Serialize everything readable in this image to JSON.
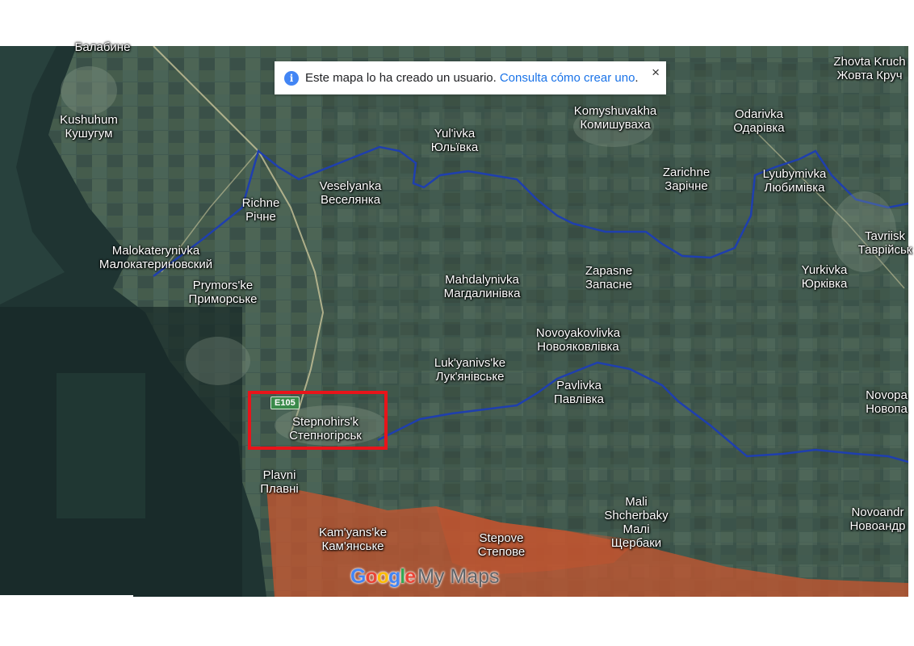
{
  "banner": {
    "text": "Este mapa lo ha creado un usuario.",
    "link": "Consulta cómo crear uno",
    "suffix": ".",
    "close": "×",
    "info_icon": "i"
  },
  "highway": "E105",
  "logo": {
    "g1": "G",
    "g2": "o",
    "g3": "o",
    "g4": "g",
    "g5": "l",
    "g6": "e",
    "mymaps": "My Maps"
  },
  "places": [
    {
      "id": "balabyne",
      "latin": "",
      "cyr": "Балабине"
    },
    {
      "id": "kushuhum",
      "latin": "Kushuhum",
      "cyr": "Кушугум"
    },
    {
      "id": "richne",
      "latin": "Richne",
      "cyr": "Річне"
    },
    {
      "id": "veselyanka",
      "latin": "Veselyanka",
      "cyr": "Веселянка"
    },
    {
      "id": "yulivka",
      "latin": "Yul'ivka",
      "cyr": "Юльївка"
    },
    {
      "id": "komyshuvakha",
      "latin": "Komyshuvakha",
      "cyr": "Комишуваха"
    },
    {
      "id": "odarivka",
      "latin": "Odarivka",
      "cyr": "Одарівка"
    },
    {
      "id": "zhovta",
      "latin": "Zhovta Kruch",
      "cyr": "Жовта Круч"
    },
    {
      "id": "zarichne",
      "latin": "Zarichne",
      "cyr": "Зарічне"
    },
    {
      "id": "lyubymivka",
      "latin": "Lyubymivka",
      "cyr": "Любимівка"
    },
    {
      "id": "tavriisk",
      "latin": "Tavriisk",
      "cyr": "Таврійськ"
    },
    {
      "id": "malokaterynivka",
      "latin": "Malokaterynivka",
      "cyr": "Малокатериновский"
    },
    {
      "id": "prymorske",
      "latin": "Prymors'ke",
      "cyr": "Приморське"
    },
    {
      "id": "mahdalynivka",
      "latin": "Mahdalynivka",
      "cyr": "Магдалинівка"
    },
    {
      "id": "zapasne",
      "latin": "Zapasne",
      "cyr": "Запасне"
    },
    {
      "id": "yurkivka",
      "latin": "Yurkivka",
      "cyr": "Юрківка"
    },
    {
      "id": "novoyakovlivka",
      "latin": "Novoyakovlivka",
      "cyr": "Новояковлівка"
    },
    {
      "id": "lukyanivske",
      "latin": "Luk'yanivs'ke",
      "cyr": "Лук'янівське"
    },
    {
      "id": "pavlivka",
      "latin": "Pavlivka",
      "cyr": "Павлівка"
    },
    {
      "id": "novopavlivka",
      "latin": "Novopa",
      "cyr": "Новопа"
    },
    {
      "id": "stepnohirsk",
      "latin": "Stepnohirs'k",
      "cyr": "Степногірськ"
    },
    {
      "id": "plavni",
      "latin": "Plavni",
      "cyr": "Плавні"
    },
    {
      "id": "malishcherbaky",
      "latin": "Mali Shcherbaky",
      "cyr": "Малі Щербаки"
    },
    {
      "id": "novoandriivka",
      "latin": "Novoandr",
      "cyr": "Новоандр"
    },
    {
      "id": "kamianske",
      "latin": "Kam'yans'ke",
      "cyr": "Кам'янське"
    },
    {
      "id": "stepove",
      "latin": "Stepove",
      "cyr": "Степове"
    }
  ],
  "colors": {
    "front_line": "#1f3fae",
    "occupied": "#c8552f",
    "highlight_box": "#e8141a",
    "water": "#1d302e",
    "land": "#40584f",
    "link": "#1a73e8"
  }
}
